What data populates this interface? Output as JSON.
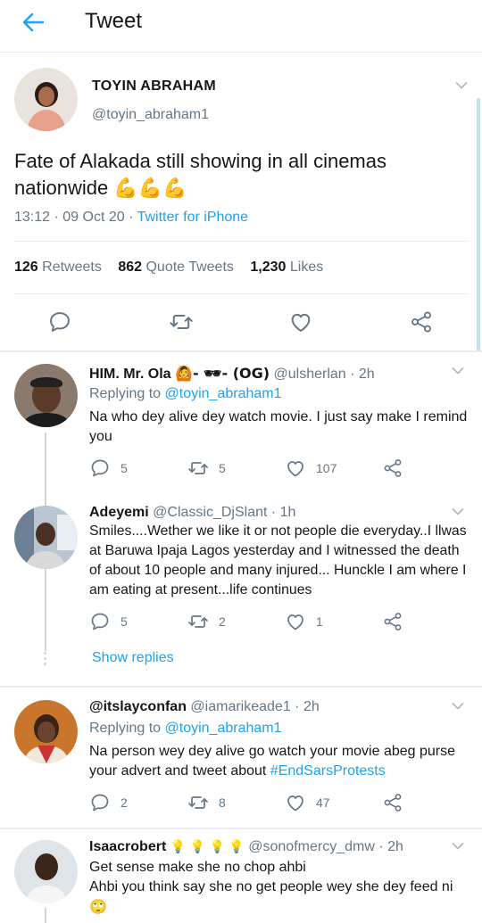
{
  "header": {
    "title": "Tweet"
  },
  "main_tweet": {
    "name": "TOYIN ABRAHAM",
    "handle": "@toyin_abraham1",
    "text": "Fate of Alakada still showing in all cinemas nationwide",
    "emojis": "💪💪💪",
    "time": "13:12 · 09 Oct 20 · ",
    "source": "Twitter for iPhone",
    "stats": {
      "retweets_count": "126",
      "retweets_label": "Retweets",
      "quotes_count": "862",
      "quotes_label": "Quote Tweets",
      "likes_count": "1,230",
      "likes_label": "Likes"
    }
  },
  "replies": [
    {
      "name": "HIM. Mr. Ola",
      "name_suffix": "🙆- 🕶- (OG)",
      "handle": "@ulsherlan",
      "time": " · 2h",
      "replying_label": "Replying to ",
      "replying_to": "@toyin_abraham1",
      "text": "Na who dey alive dey watch movie. I just say make I remind you",
      "replies": "5",
      "retweets": "5",
      "likes": "107"
    },
    {
      "name": "Adeyemi",
      "handle": "@Classic_DjSlant",
      "time": " · 1h",
      "text": "Smiles....Wether we like it or not people die everyday..I llwas at Baruwa Ipaja Lagos yesterday and I witnessed the death of about 10 people and many injured... Hunckle I am where I am eating at present...life continues",
      "replies": "5",
      "retweets": "2",
      "likes": "1",
      "show_replies": "Show replies"
    },
    {
      "name": "@itslayconfan",
      "handle": "@iamarikeade1",
      "time": " · 2h",
      "replying_label": "Replying to ",
      "replying_to": "@toyin_abraham1",
      "text": "Na person wey dey alive go watch your movie abeg purse your advert and tweet about ",
      "hashtag": "#EndSarsProtests",
      "replies": "2",
      "retweets": "8",
      "likes": "47"
    },
    {
      "name": "Isaacrobert",
      "name_suffix": "💡 💡 💡 💡",
      "handle": "@sonofmercy_dmw",
      "time": " · 2h",
      "text_line1": "Get sense make she no chop ahbi",
      "text_line2": "Ahbi you think say she no get people wey she dey feed ni",
      "text_emoji": "🙄"
    }
  ],
  "colors": {
    "accent": "#1da1f2",
    "muted": "#657786",
    "text": "#14171a",
    "divider": "#e6ecf0"
  },
  "icons": [
    "back-arrow-icon",
    "chevron-down-icon",
    "reply-icon",
    "retweet-icon",
    "like-icon",
    "share-icon"
  ]
}
